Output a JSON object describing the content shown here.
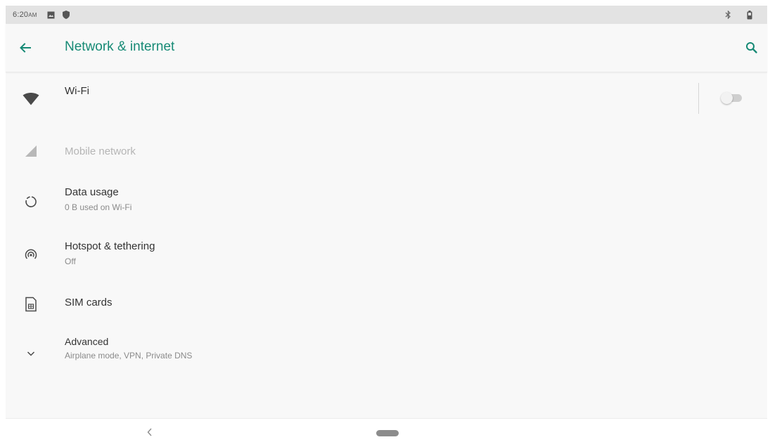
{
  "status_bar": {
    "time": "6:20",
    "ampm": "AM"
  },
  "toolbar": {
    "title": "Network & internet",
    "back_icon": "arrow-back-icon",
    "search_icon": "search-icon"
  },
  "items": [
    {
      "title": "Wi-Fi",
      "subtitle": "",
      "icon": "wifi-icon",
      "toggle": false
    },
    {
      "title": "Mobile network",
      "subtitle": "",
      "icon": "signal-icon",
      "disabled": true
    },
    {
      "title": "Data usage",
      "subtitle": "0 B used on Wi-Fi",
      "icon": "data-usage-icon"
    },
    {
      "title": "Hotspot & tethering",
      "subtitle": "Off",
      "icon": "hotspot-icon"
    },
    {
      "title": "SIM cards",
      "subtitle": "",
      "icon": "sim-card-icon"
    },
    {
      "title": "Advanced",
      "subtitle": "Airplane mode, VPN, Private DNS",
      "icon": "chevron-down-icon"
    }
  ],
  "colors": {
    "accent": "#168a75",
    "background": "#f8f8f8",
    "status_bar": "#e3e3e3"
  }
}
